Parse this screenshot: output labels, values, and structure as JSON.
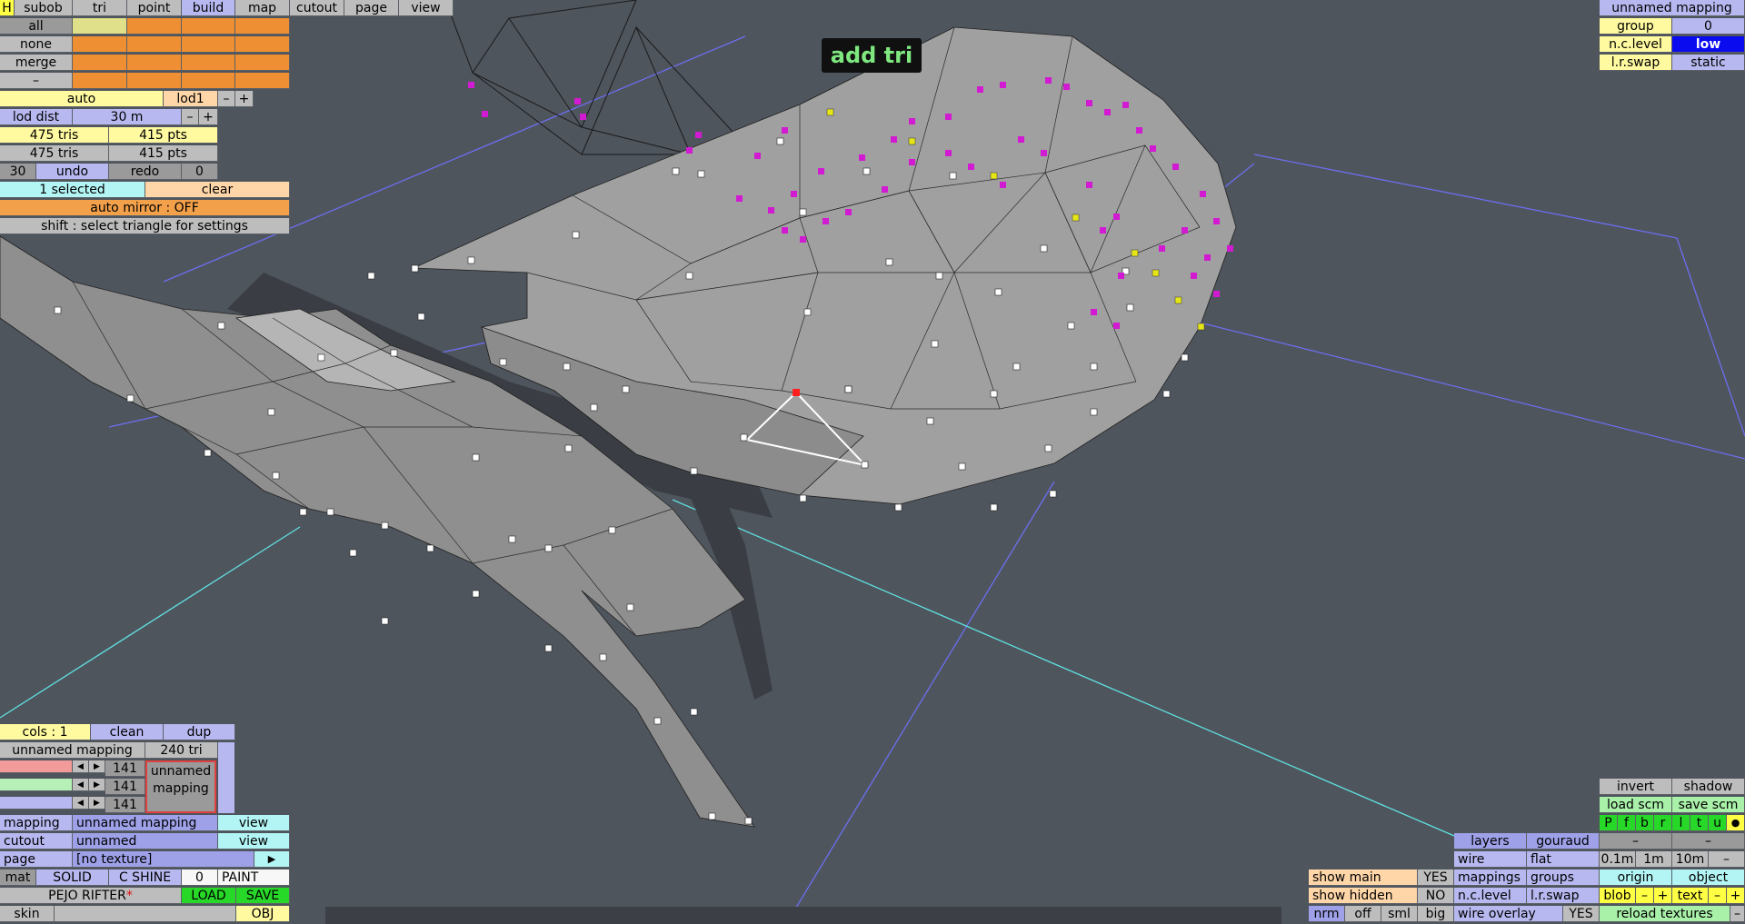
{
  "top_menu": {
    "h": "H",
    "tabs": [
      "subob",
      "tri",
      "point",
      "build",
      "map",
      "cutout",
      "page",
      "view"
    ]
  },
  "left_panel": {
    "sel_buttons": [
      "all",
      "none",
      "merge",
      "–"
    ],
    "auto": "auto",
    "lod": "lod1",
    "minus": "–",
    "plus": "+",
    "lod_dist_label": "lod dist",
    "lod_dist_value": "30 m",
    "tris1": "475 tris",
    "pts1": "415 pts",
    "tris2": "475 tris",
    "pts2": "415 pts",
    "undo_count": "30",
    "undo": "undo",
    "redo": "redo",
    "redo_count": "0",
    "selected": "1 selected",
    "clear": "clear",
    "auto_mirror": "auto mirror : OFF",
    "shift_hint": "shift : select triangle for settings"
  },
  "tooltip": "add tri",
  "top_right": {
    "title": "unnamed mapping",
    "group_label": "group",
    "group_value": "0",
    "nclevel_label": "n.c.level",
    "nclevel_value": "low",
    "lrswap_label": "l.r.swap",
    "lrswap_value": "static"
  },
  "bottom_left": {
    "cols": "cols : 1",
    "clean": "clean",
    "dup": "dup",
    "mapping_name": "unnamed mapping",
    "tri_count": "240 tri",
    "channel_values": [
      "141",
      "141",
      "141"
    ],
    "preview_text": "unnamed mapping",
    "mapping_label": "mapping",
    "mapping_value": "unnamed mapping",
    "view1": "view",
    "cutout_label": "cutout",
    "cutout_value": "unnamed",
    "view2": "view",
    "page_label": "page",
    "page_value": "[no texture]",
    "page_arrow": "▶",
    "mat": "mat",
    "solid": "SOLID",
    "cshine": "C SHINE",
    "mat_num": "0",
    "paint": "PAINT",
    "model_name": "PEJO RIFTER",
    "model_mark": "*",
    "load": "LOAD",
    "save": "SAVE",
    "skin": "skin",
    "obj": "OBJ"
  },
  "bottom_right": {
    "invert": "invert",
    "shadow": "shadow",
    "load_scm": "load scm",
    "save_scm": "save scm",
    "flags": [
      "P",
      "f",
      "b",
      "r",
      "l",
      "t",
      "u",
      "●"
    ],
    "layers": "layers",
    "gouraud": "gouraud",
    "dash1": "–",
    "dash2": "–",
    "wire": "wire",
    "flat": "flat",
    "d01": "0.1m",
    "d1": "1m",
    "d10": "10m",
    "dminus": "–",
    "show_main": "show main",
    "show_main_v": "YES",
    "mappings": "mappings",
    "groups": "groups",
    "origin": "origin",
    "object": "object",
    "show_hidden": "show hidden",
    "show_hidden_v": "NO",
    "nclevel": "n.c.level",
    "lrswap": "l.r.swap",
    "blob": "blob",
    "blob_m": "–",
    "blob_p": "+",
    "text": "text",
    "text_m": "–",
    "text_p": "+",
    "nrm": "nrm",
    "off": "off",
    "sml": "sml",
    "big": "big",
    "wire_overlay": "wire overlay",
    "wire_overlay_v": "YES",
    "reload": "reload textures",
    "reload_m": "–"
  },
  "colors": {
    "background": "#4f555d",
    "mesh": "#9b9b9b",
    "selection": "#d21ad2",
    "accent_yellow": "#e6e617"
  }
}
